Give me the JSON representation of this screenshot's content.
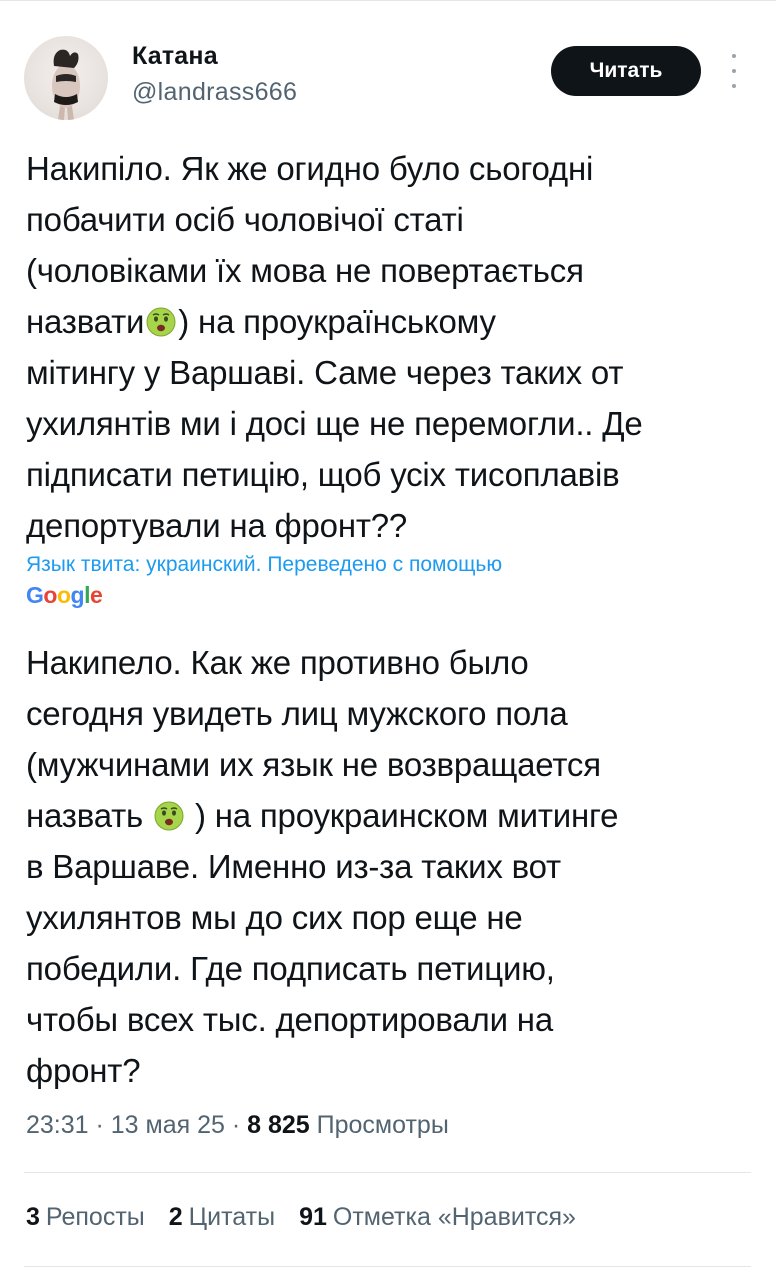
{
  "author": {
    "name": "Катана",
    "handle": "@landrass666"
  },
  "follow_label": "Читать",
  "original_text": {
    "l1": "Накипіло. Як же огидно було сьогодні",
    "l2": "побачити осіб чоловічої статі",
    "l3": "(чоловіками їх мова не повертається",
    "l4a": "назвати",
    "l4b": ") на проукраїнському",
    "l5": "мітингу у Варшаві. Саме через таких от",
    "l6": "ухилянтів ми і досі ще не перемогли.. Де",
    "l7": "підписати петицію, щоб усіх тисоплавів",
    "l8": "депортували на фронт??"
  },
  "translation_note": "Язык твита: украинский. Переведено с помощью",
  "translation_provider": {
    "g1": "G",
    "o1": "o",
    "o2": "o",
    "g2": "g",
    "l": "l",
    "e": "e"
  },
  "translated_text": {
    "l1": "Накипело. Как же противно было",
    "l2": "сегодня увидеть лиц мужского пола",
    "l3": "(мужчинами их язык не возвращается",
    "l4a": "назвать",
    "l4b": ") на проукраинском митинге",
    "l5": "в Варшаве. Именно из-за таких вот",
    "l6": "ухилянтов мы до сих пор еще не",
    "l7": "победили. Где подписать петицию,",
    "l8": "чтобы всех тыс. депортировали на",
    "l9": "фронт?"
  },
  "meta": {
    "time": "23:31",
    "sep1": " · ",
    "date": "13 мая 25",
    "sep2": " · ",
    "views_count": "8 825",
    "views_label": "Просмотры"
  },
  "stats": {
    "reposts_count": "3",
    "reposts_label": "Репосты",
    "quotes_count": "2",
    "quotes_label": "Цитаты",
    "likes_count": "91",
    "likes_label": "Отметка «Нравится»"
  },
  "emoji": "nauseated-face-emoji"
}
